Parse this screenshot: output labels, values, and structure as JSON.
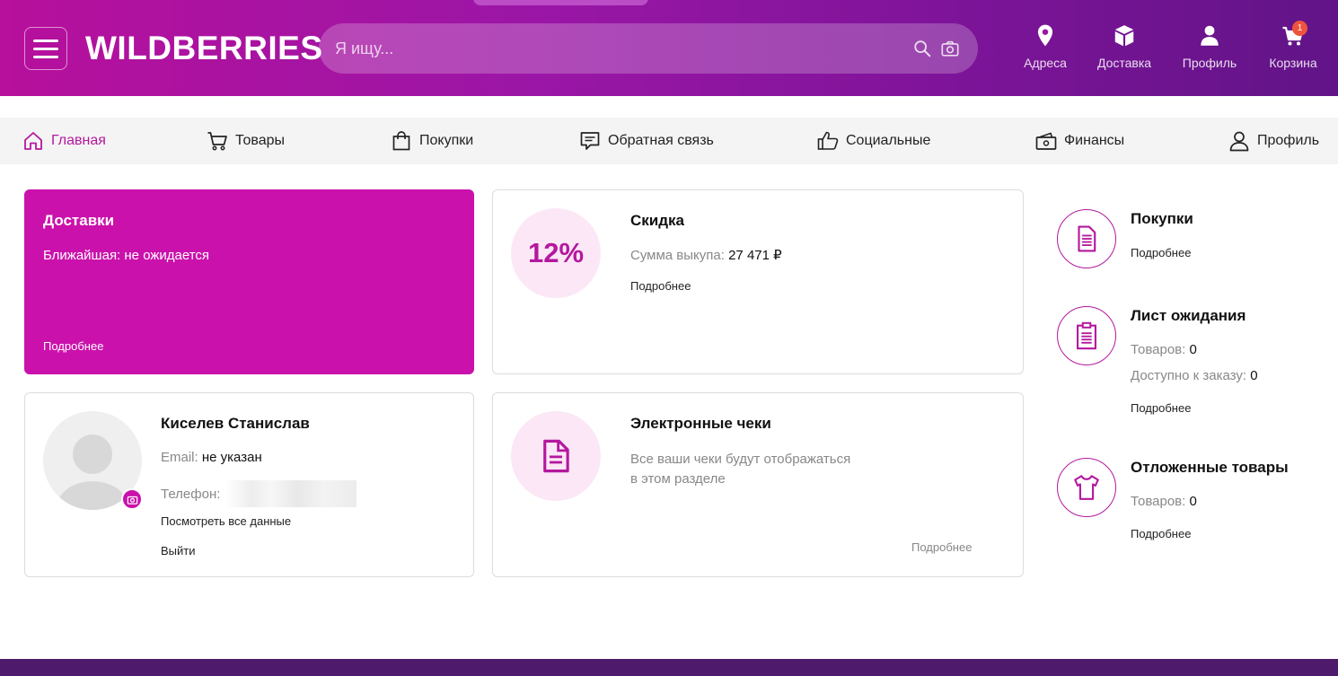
{
  "header": {
    "logo": "WILDBERRIES",
    "search_placeholder": "Я ищу...",
    "nav": {
      "addresses": "Адреса",
      "delivery": "Доставка",
      "profile": "Профиль",
      "cart": "Корзина",
      "cart_count": "1"
    }
  },
  "subnav": {
    "home": "Главная",
    "goods": "Товары",
    "purchases": "Покупки",
    "feedback": "Обратная связь",
    "social": "Социальные",
    "finance": "Финансы",
    "profile": "Профиль"
  },
  "deliveries": {
    "title": "Доставки",
    "nearest": "Ближайшая: не ожидается",
    "more": "Подробнее"
  },
  "discount": {
    "percent": "12%",
    "title": "Скидка",
    "sum_label": "Сумма выкупа:",
    "sum_value": "27 471 ₽",
    "more": "Подробнее"
  },
  "profile_card": {
    "name": "Киселев Станислав",
    "email_label": "Email:",
    "email_value": "не указан",
    "phone_label": "Телефон:",
    "view_all": "Посмотреть все данные",
    "logout": "Выйти"
  },
  "receipts": {
    "title": "Электронные чеки",
    "desc_line1": "Все ваши чеки будут отображаться",
    "desc_line2": "в этом разделе",
    "more": "Подробнее"
  },
  "side": {
    "purchases": {
      "title": "Покупки",
      "more": "Подробнее"
    },
    "waitlist": {
      "title": "Лист ожидания",
      "goods_label": "Товаров:",
      "goods_value": "0",
      "available_label": "Доступно к заказу:",
      "available_value": "0",
      "more": "Подробнее"
    },
    "postponed": {
      "title": "Отложенные товары",
      "goods_label": "Товаров:",
      "goods_value": "0",
      "more": "Подробнее"
    }
  },
  "colors": {
    "brand": "#cb11ab",
    "header_start": "#b6109c",
    "header_end": "#611487",
    "icon_accent": "#b4189e",
    "discount_bg": "#fbe7f6"
  },
  "icons": [
    "menu-icon",
    "search-icon",
    "camera-icon",
    "pin-icon",
    "box-icon",
    "user-icon",
    "cart-icon",
    "home-icon",
    "shopping-cart-icon",
    "bag-icon",
    "chat-icon",
    "thumb-up-icon",
    "wallet-icon",
    "profile-icon",
    "document-icon",
    "clipboard-icon",
    "tshirt-icon",
    "avatar-camera-icon"
  ]
}
